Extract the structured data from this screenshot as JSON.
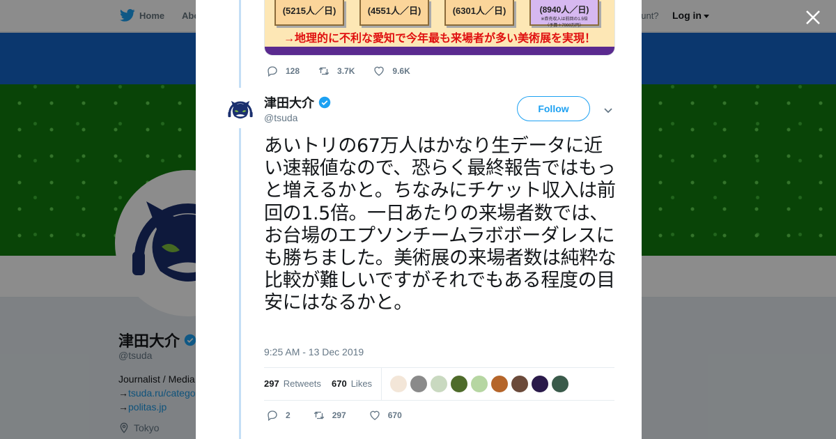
{
  "nav": {
    "home_label": "Home",
    "about_label": "Abo",
    "account_text": "ccount?",
    "login_label": "Log in"
  },
  "profile": {
    "name": "津田大介",
    "handle": "@tsuda",
    "bio_line1": "Journalist / Media",
    "link1_prefix": "→",
    "link1": "tsuda.ru/catego",
    "link2_prefix": "→",
    "link2": "politas.jp",
    "location": "Tokyo"
  },
  "previous_tweet": {
    "media": {
      "box1": "(5215人／日)",
      "box2": "(4551人／日)",
      "box3": "(6301人／日)",
      "box4": "(8940人／日)",
      "box4_note1": "※券売収入は前回の1.5倍",
      "box4_note2": "（予算＋7000万円）",
      "caption": "→地理的に不利な愛知で今年最も来場者が多い美術展を実現！"
    },
    "replies": "128",
    "retweets": "3.7K",
    "likes": "9.6K"
  },
  "tweet": {
    "author_name": "津田大介",
    "author_handle": "@tsuda",
    "follow_label": "Follow",
    "text": "あいトリの67万人はかなり生データに近い速報値なので、恐らく最終報告ではもっと増えるかと。ちなみにチケット収入は前回の1.5倍。一日あたりの来場者数では、お台場のエプソンチームラボボーダレスにも勝ちました。美術展の来場者数は純粋な比較が難しいですがそれでもある程度の目安にはなるかと。",
    "timestamp": "9:25 AM - 13 Dec 2019",
    "retweets_count": "297",
    "retweets_label": "Retweets",
    "likes_count": "670",
    "likes_label": "Likes",
    "replies": "2",
    "retweet_action_count": "297",
    "like_action_count": "670"
  },
  "colors": {
    "twitter_blue": "#1da1f2",
    "verified": "#1da1f2",
    "text_primary": "#14171a",
    "text_secondary": "#657786"
  }
}
